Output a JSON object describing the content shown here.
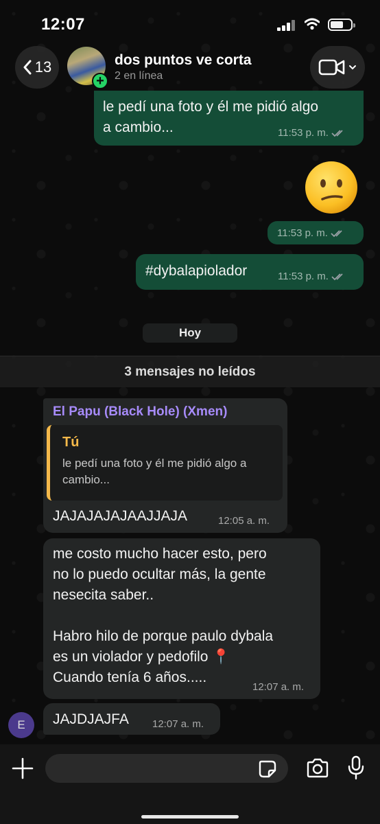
{
  "status_bar": {
    "time": "12:07"
  },
  "header": {
    "back_count": "13",
    "chat_name": "dos puntos ve corta",
    "subtitle": "2 en línea"
  },
  "messages": [
    {
      "direction": "out",
      "text": "le pedí una foto y él me pidió algo\na cambio...",
      "time": "11:53 p. m.",
      "ticks": "read"
    },
    {
      "direction": "out",
      "emoji": "😕",
      "time": "11:53 p. m.",
      "ticks": "read"
    },
    {
      "direction": "out",
      "text": "#dybalapiolador",
      "time": "11:53 p. m.",
      "ticks": "read"
    },
    {
      "direction": "in",
      "sender": "El Papu (Black Hole) (Xmen)",
      "quote_author": "Tú",
      "quote_text": "le pedí una foto y él me pidió algo a cambio...",
      "text": "JAJAJAJAJAAJJAJA",
      "time": "12:05 a. m."
    },
    {
      "direction": "in",
      "text": "me costo mucho hacer esto, pero\nno lo puedo ocultar más, la gente\nnesecita saber..\n\nHabro hilo de porque paulo dybala\nes un violador y pedofilo 📍\nCuando tenía 6 años.....",
      "time": "12:07 a. m."
    },
    {
      "direction": "in",
      "avatar_letter": "E",
      "text": "JAJDJAJFA",
      "time": "12:07 a. m."
    }
  ],
  "day_label": "Hoy",
  "unread_label": "3 mensajes no leídos",
  "input": {
    "placeholder": ""
  },
  "icons": {
    "back": "chevron-left-icon",
    "video": "video-camera-icon",
    "plus": "plus-icon",
    "sticker": "sticker-icon",
    "camera": "camera-icon",
    "mic": "microphone-icon"
  },
  "colors": {
    "outgoing_bubble": "#144d37",
    "incoming_bubble": "#242626",
    "sender_name": "#a78bfa",
    "quote_accent": "#f5b94a",
    "read_ticks": "#9aa0a6"
  }
}
